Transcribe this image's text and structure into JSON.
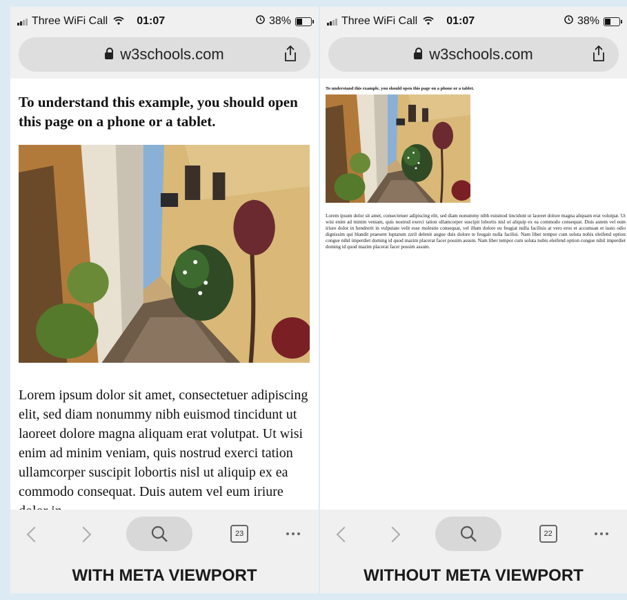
{
  "left": {
    "status": {
      "carrier": "Three WiFi Call",
      "time": "01:07",
      "battery": "38%",
      "battery_level": 0.38
    },
    "url": "w3schools.com",
    "heading": "To understand this example, you should open this page on a phone or a tablet.",
    "body_text": "Lorem ipsum dolor sit amet, consectetuer adipiscing elit, sed diam nonummy nibh euismod tincidunt ut laoreet dolore magna aliquam erat volutpat. Ut wisi enim ad minim veniam, quis nostrud exerci tation ullamcorper suscipit lobortis nisl ut aliquip ex ea commodo consequat. Duis autem vel eum iriure dolor in",
    "tab_count": "23",
    "caption": "WITH META VIEWPORT"
  },
  "right": {
    "status": {
      "carrier": "Three WiFi Call",
      "time": "01:07",
      "battery": "38%",
      "battery_level": 0.38
    },
    "url": "w3schools.com",
    "heading": "To understand this example, you should open this page on a phone or a tablet.",
    "body_text": "Lorem ipsum dolor sit amet, consectetuer adipiscing elit, sed diam nonummy nibh euismod tincidunt ut laoreet dolore magna aliquam erat volutpat. Ut wisi enim ad minim veniam, quis nostrud exerci tation ullamcorper suscipit lobortis nisl ut aliquip ex ea commodo consequat. Duis autem vel eum iriure dolor in hendrerit in vulputate velit esse molestie consequat, vel illum dolore eu feugiat nulla facilisis at vero eros et accumsan et iusto odio dignissim qui blandit praesent luptatum zzril delenit augue duis dolore te feugait nulla facilisi. Nam liber tempor cum soluta nobis eleifend option congue nihil imperdiet doming id quod mazim placerat facer possim assum. Nam liber tempor cum soluta nobis eleifend option congue nihil imperdiet doming id quod mazim placerat facer possim assum.",
    "tab_count": "22",
    "caption": "WITHOUT META VIEWPORT"
  },
  "icons": {
    "lock": "lock-icon",
    "share": "share-icon",
    "back": "chevron-left-icon",
    "forward": "chevron-right-icon",
    "search": "search-icon",
    "tabs": "tabs-icon",
    "more": "more-icon",
    "wifi": "wifi-icon",
    "alarm": "alarm-icon"
  },
  "colors": {
    "background": "#dcebf3",
    "panel": "#f0f0f0",
    "url_bar": "#dedede"
  }
}
